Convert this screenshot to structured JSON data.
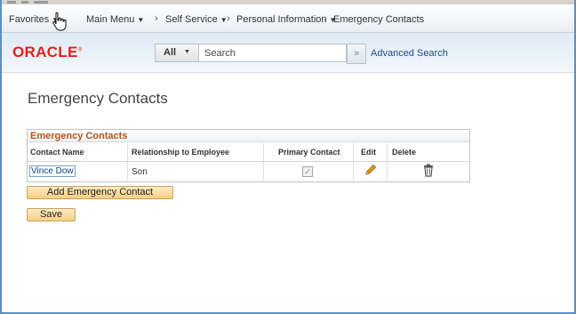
{
  "nav": {
    "favorites": "Favorites",
    "main_menu": "Main Menu",
    "breadcrumbs": [
      "Self Service",
      "Personal Information",
      "Emergency Contacts"
    ]
  },
  "header": {
    "logo": "ORACLE",
    "search_category": "All",
    "search_placeholder": "Search",
    "advanced_search": "Advanced Search"
  },
  "page": {
    "title": "Emergency Contacts"
  },
  "grid": {
    "title": "Emergency Contacts",
    "columns": [
      "Contact Name",
      "Relationship to Employee",
      "Primary Contact",
      "Edit",
      "Delete"
    ],
    "rows": [
      {
        "contact_name": "Vince Dow",
        "relationship": "Son",
        "primary_contact": true
      }
    ]
  },
  "buttons": {
    "add_contact": "Add Emergency Contact",
    "save": "Save"
  },
  "colors": {
    "accent_blue": "#5b8fc8",
    "oracle_red": "#e2211c",
    "grid_title_orange": "#b6541a",
    "button_fill": "#f6cf83",
    "pencil": "#e39b14"
  },
  "icons": [
    "caret-down-icon",
    "pointer-cursor-icon",
    "double-chevron-right-icon",
    "pencil-icon",
    "trash-icon",
    "checkbox-checked-icon"
  ]
}
